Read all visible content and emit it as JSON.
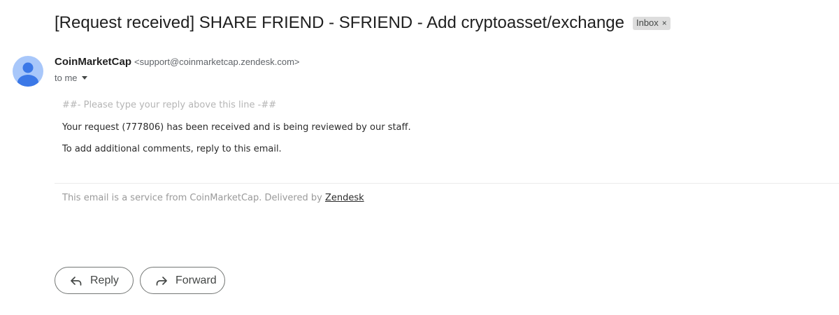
{
  "email": {
    "subject": "[Request received] SHARE FRIEND - SFRIEND - Add cryptoasset/exchange",
    "label": "Inbox",
    "label_remove": "×",
    "sender_name": "CoinMarketCap",
    "sender_email": "<support@coinmarketcap.zendesk.com>",
    "recipient": "to me",
    "body": {
      "reply_marker": "##- Please type your reply above this line -##",
      "line1": "Your request (777806) has been received and is being reviewed by our staff.",
      "line2": "To add additional comments, reply to this email."
    },
    "footer": {
      "text": "This email is a service from CoinMarketCap. Delivered by ",
      "link": "Zendesk"
    }
  },
  "actions": {
    "reply_label": "Reply",
    "forward_label": "Forward"
  },
  "icons": {
    "avatar": "person-icon",
    "reply": "reply-arrow-icon",
    "forward": "forward-arrow-icon",
    "recipient_details": "caret-down-icon"
  },
  "colors": {
    "avatar_bg": "#a8c7fa",
    "avatar_figure": "#3b78e7",
    "label_chip_bg": "#dddddd"
  }
}
